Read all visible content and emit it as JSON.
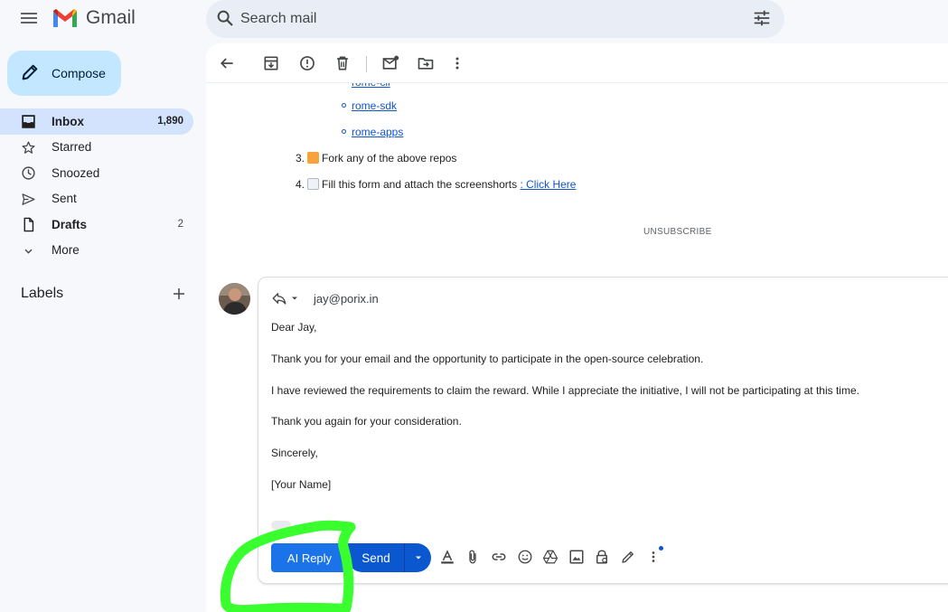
{
  "app": {
    "name": "Gmail",
    "colors": {
      "accent": "#0b57d0",
      "compose_bg": "#c2e7ff",
      "active_nav": "#d3e3fd",
      "annotation": "#39ff2e"
    }
  },
  "search": {
    "placeholder": "Search mail"
  },
  "sidebar": {
    "compose_label": "Compose",
    "items": [
      {
        "label": "Inbox",
        "count": "1,890",
        "icon": "inbox-icon",
        "active": true
      },
      {
        "label": "Starred",
        "count": "",
        "icon": "star-icon"
      },
      {
        "label": "Snoozed",
        "count": "",
        "icon": "clock-icon"
      },
      {
        "label": "Sent",
        "count": "",
        "icon": "send-icon"
      },
      {
        "label": "Drafts",
        "count": "2",
        "icon": "file-icon"
      },
      {
        "label": "More",
        "count": "",
        "icon": "chevron-down-icon"
      }
    ],
    "labels_title": "Labels"
  },
  "message": {
    "cut_link": "rome-cli",
    "sub_links": [
      "rome-sdk",
      "rome-apps"
    ],
    "step3_num": "3.",
    "step3_text": "Fork any of the above repos",
    "step4_num": "4.",
    "step4_text": "Fill this form and attach the screenshorts ",
    "step4_link": ": Click Here",
    "unsubscribe": "UNSUBSCRIBE"
  },
  "reply": {
    "to": "jay@porix.in",
    "lines": [
      "Dear Jay,",
      "Thank you for your email and the opportunity to participate in the open-source celebration.",
      "I have reviewed the requirements to claim the reward. While I appreciate the initiative, I will not be participating at this time.",
      "Thank you again for your consideration.",
      "Sincerely,",
      "[Your Name]"
    ],
    "ai_reply_label": "AI Reply",
    "send_label": "Send"
  }
}
